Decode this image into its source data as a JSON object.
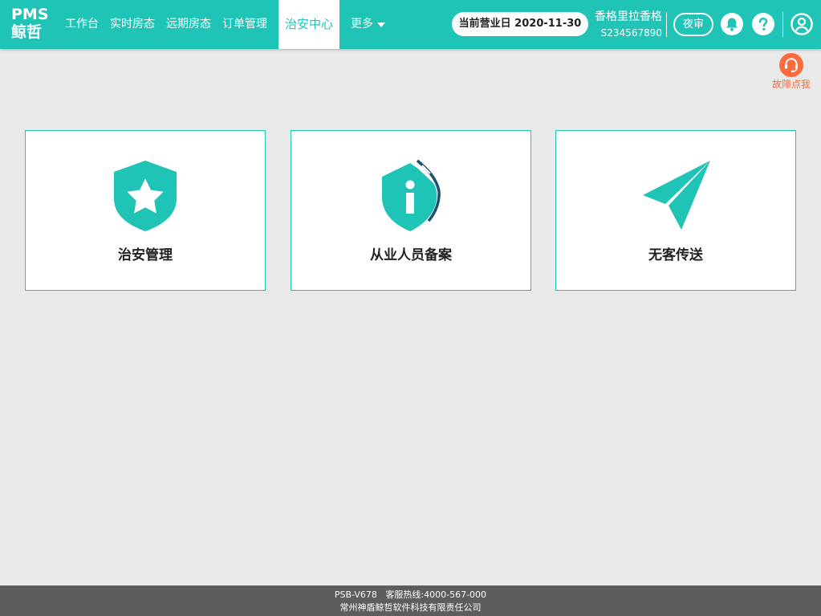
{
  "brand": {
    "line1": "PMS",
    "line2": "鲸哲"
  },
  "nav": {
    "items": [
      "工作台",
      "实时房态",
      "远期房态",
      "订单管理"
    ],
    "active": "治安中心",
    "more": "更多"
  },
  "header": {
    "business_date": "当前营业日 2020-11-30",
    "hotel_name": "香格里拉香格",
    "hotel_code": "S234567890",
    "night_audit": "夜审"
  },
  "fault": {
    "label": "故障点我"
  },
  "cards": [
    {
      "label": "治安管理",
      "icon": "shield-star-icon"
    },
    {
      "label": "从业人员备案",
      "icon": "shield-info-icon"
    },
    {
      "label": "无客传送",
      "icon": "paper-plane-icon"
    }
  ],
  "footer": {
    "line1": "PSB-V678   客服热线:4000-567-000",
    "line2": "常州神盾鲸哲软件科技有限责任公司"
  },
  "colors": {
    "accent": "#1fc4b7",
    "fault": "#ff6a3d",
    "footer": "#5d5d5d",
    "background": "#e9e9e9",
    "shield_dark": "#1d4f6e"
  }
}
